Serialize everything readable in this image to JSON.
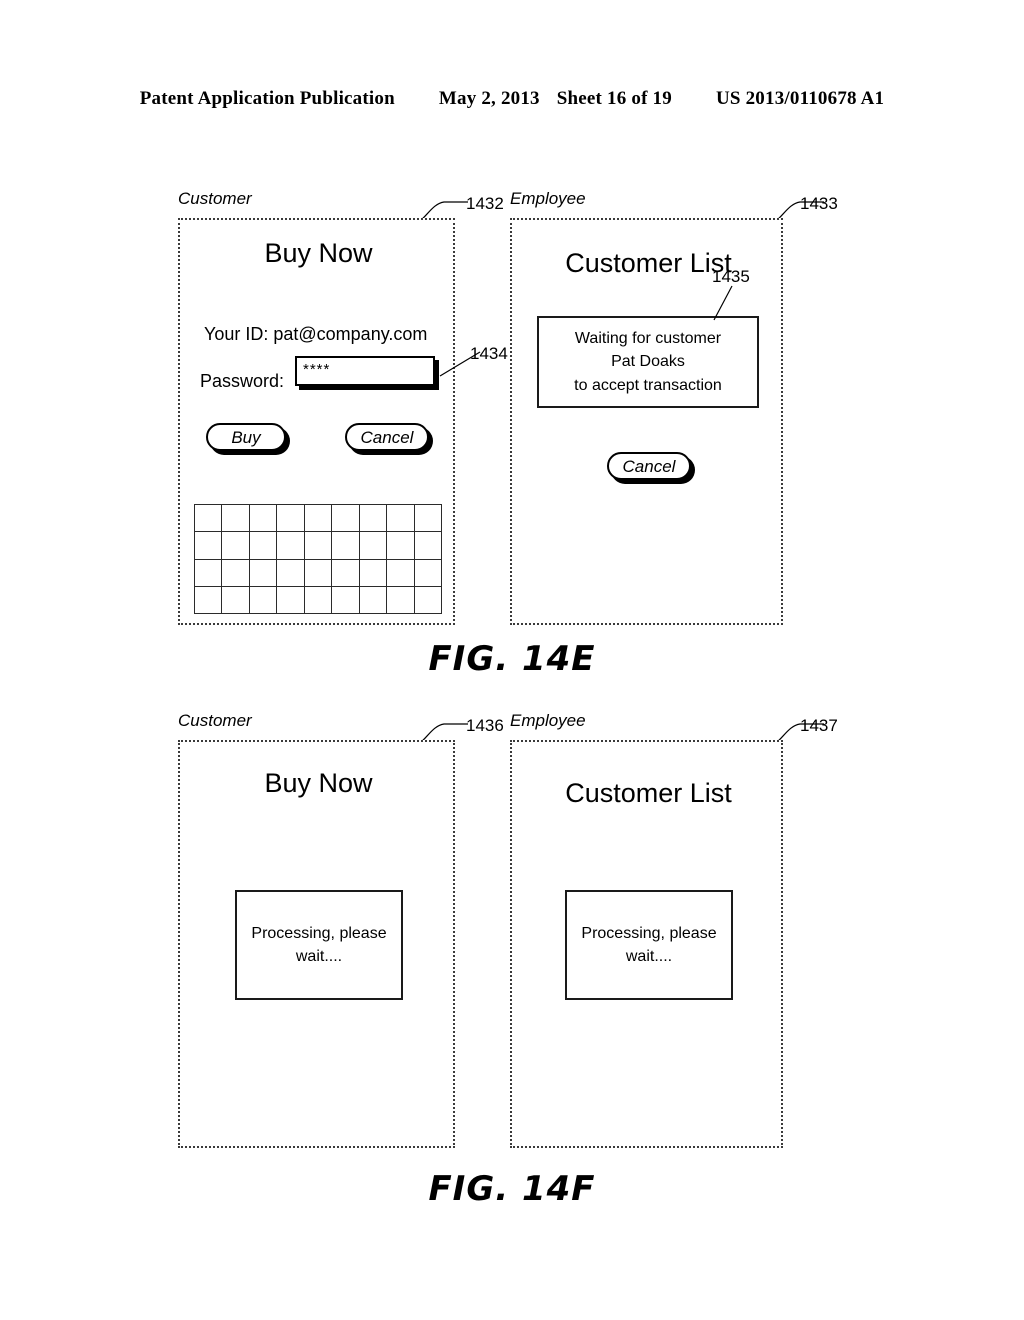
{
  "header": {
    "publication": "Patent Application Publication",
    "date": "May 2, 2013",
    "sheet": "Sheet 16 of 19",
    "patent_number": "US 2013/0110678 A1"
  },
  "figures": [
    {
      "caption": "FIG. 14E",
      "panels": [
        {
          "role_label": "Customer",
          "ref": "1432",
          "title": "Buy Now",
          "id_line": "Your ID: pat@company.com",
          "password_label": "Password:",
          "password_value": "****",
          "password_ref": "1434",
          "buttons": [
            {
              "label": "Buy"
            },
            {
              "label": "Cancel"
            }
          ],
          "grid": {
            "columns": 9,
            "rows": 4
          }
        },
        {
          "role_label": "Employee",
          "ref": "1433",
          "title": "Customer List",
          "dialog_ref": "1435",
          "dialog_lines": [
            "Waiting for customer",
            "Pat Doaks",
            "to accept transaction"
          ],
          "buttons": [
            {
              "label": "Cancel"
            }
          ]
        }
      ]
    },
    {
      "caption": "FIG. 14F",
      "panels": [
        {
          "role_label": "Customer",
          "ref": "1436",
          "title": "Buy Now",
          "dialog_lines": [
            "Processing, please",
            "wait...."
          ]
        },
        {
          "role_label": "Employee",
          "ref": "1437",
          "title": "Customer List",
          "dialog_lines": [
            "Processing, please",
            "wait...."
          ]
        }
      ]
    }
  ]
}
